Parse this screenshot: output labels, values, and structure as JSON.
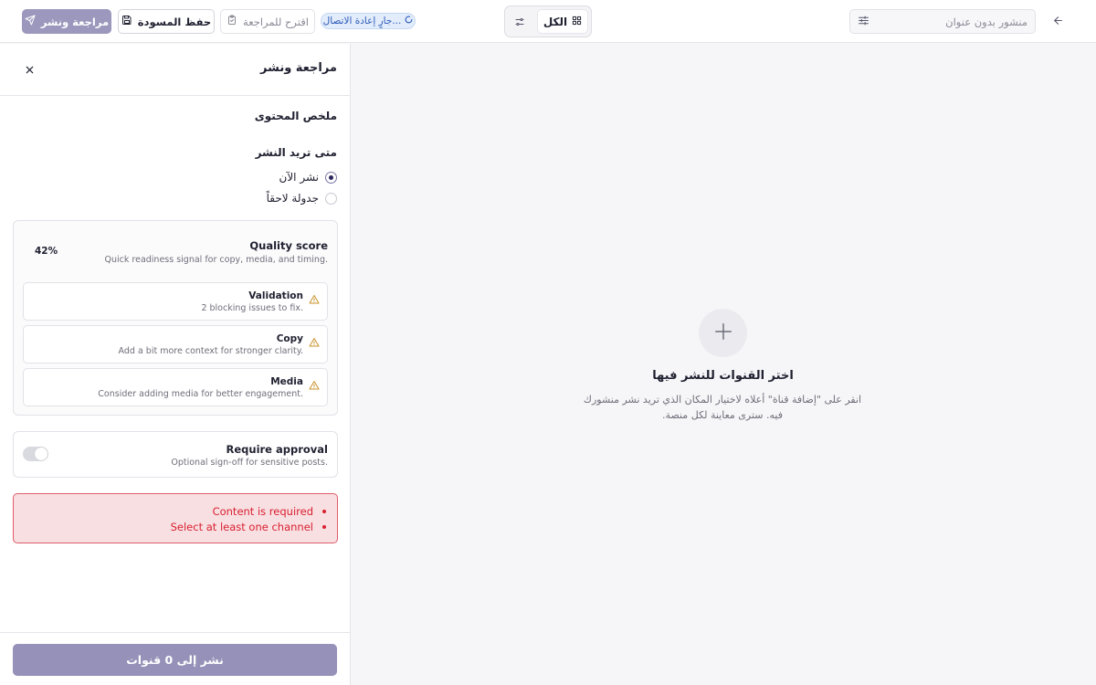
{
  "toolbar": {
    "review_publish_label": "مراجعة ونشر",
    "save_draft_label": "حفظ المسودة",
    "suggest_review_label": "اقترح للمراجعة",
    "reconnecting_label": "جارٍ إعادة الاتصال...",
    "filter_all_label": "الكل",
    "title_placeholder": "منشور بدون عنوان"
  },
  "panel": {
    "title": "مراجعة ونشر",
    "content_summary": "ملخص المحتوى",
    "when_publish": "متى تريد النشر",
    "schedule_options": [
      {
        "label": "نشر الآن",
        "selected": true
      },
      {
        "label": "جدولة لاحقاً",
        "selected": false
      }
    ],
    "quality": {
      "title": "Quality score",
      "subtitle": "Quick readiness signal for copy, media, and timing.",
      "percent": "42%",
      "items": [
        {
          "name": "Validation",
          "desc": "2 blocking issues to fix.",
          "icon": "warning-icon"
        },
        {
          "name": "Copy",
          "desc": "Add a bit more context for stronger clarity.",
          "icon": "warning-icon"
        },
        {
          "name": "Media",
          "desc": "Consider adding media for better engagement.",
          "icon": "warning-icon"
        }
      ]
    },
    "approval": {
      "title": "Require approval",
      "subtitle": "Optional sign-off for sensitive posts.",
      "enabled": false
    },
    "errors": [
      "Content is required",
      "Select at least one channel"
    ],
    "publish_button": "نشر إلى 0 قنوات"
  },
  "empty_state": {
    "title": "اختر القنوات للنشر فيها",
    "description": "انقر على \"إضافة قناة\" أعلاه لاختيار المكان الذي تريد نشر منشورك فيه. سترى معاينة لكل منصة."
  },
  "colors": {
    "primary": "#9b97bd",
    "error": "#d8202f",
    "warning": "#c9922a",
    "info": "#2b5ab8"
  }
}
